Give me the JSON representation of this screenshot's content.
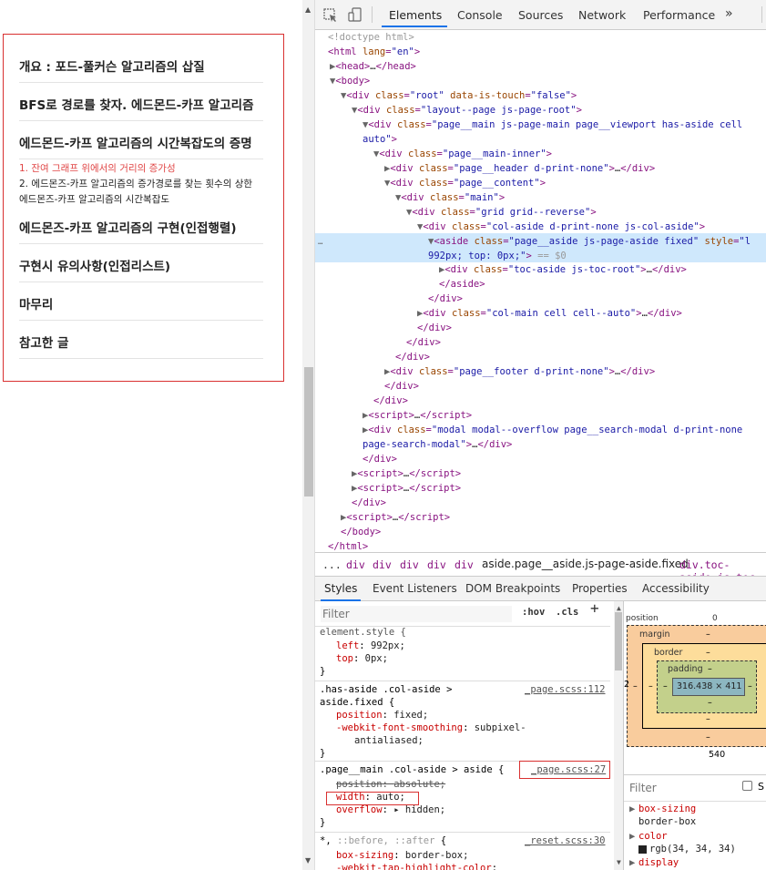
{
  "toc": {
    "items": [
      "개요 : 포드-풀커슨 알고리즘의 삽질",
      "BFS로 경로를 찾자. 에드몬드-카프 알고리즘",
      "에드몬드-카프 알고리즘의 시간복잡도의 증명"
    ],
    "subitems": [
      "1. 잔여 그래프 위에서의 거리의 증가성",
      "2. 에드몬즈-카프 알고리즘의 증가경로를 찾는 횟수의 상한",
      "에드몬즈-카프 알고리즘의 시간복잡도"
    ],
    "items2": [
      "에드몬즈-카프 알고리즘의 구현(인접행렬)",
      "구현시 유의사항(인접리스트)",
      "마무리",
      "참고한 글"
    ]
  },
  "devtools": {
    "tabs": [
      "Elements",
      "Console",
      "Sources",
      "Network",
      "Performance",
      "»"
    ],
    "active_tab": "Elements",
    "breadcrumb": [
      "...",
      "div",
      "div",
      "div",
      "div",
      "div",
      "aside.page__aside.js-page-aside.fixed",
      "div.toc-aside.js-toc"
    ],
    "styles_tabs": [
      "Styles",
      "Event Listeners",
      "DOM Breakpoints",
      "Properties",
      "Accessibility"
    ],
    "filter_placeholder": "Filter",
    "hov": ":hov",
    "cls": ".cls",
    "plus": "+",
    "dom_ellipsis": "…",
    "box": {
      "position_label": "position",
      "position_val": "0",
      "margin_label": "margin",
      "border_label": "border",
      "padding_label": "padding",
      "dash": "–",
      "content": "316.438 × 411",
      "width_below": "540",
      "side": "2"
    },
    "computed": {
      "filter_placeholder": "Filter",
      "show_label": "S",
      "props": [
        {
          "name": "box-sizing",
          "value": "border-box"
        },
        {
          "name": "color",
          "value": "rgb(34, 34, 34)"
        },
        {
          "name": "display",
          "value": ""
        }
      ]
    }
  },
  "colors": {
    "accent": "#1a73e8",
    "highlight": "#cfe8fc",
    "red_box": "#d93030"
  }
}
